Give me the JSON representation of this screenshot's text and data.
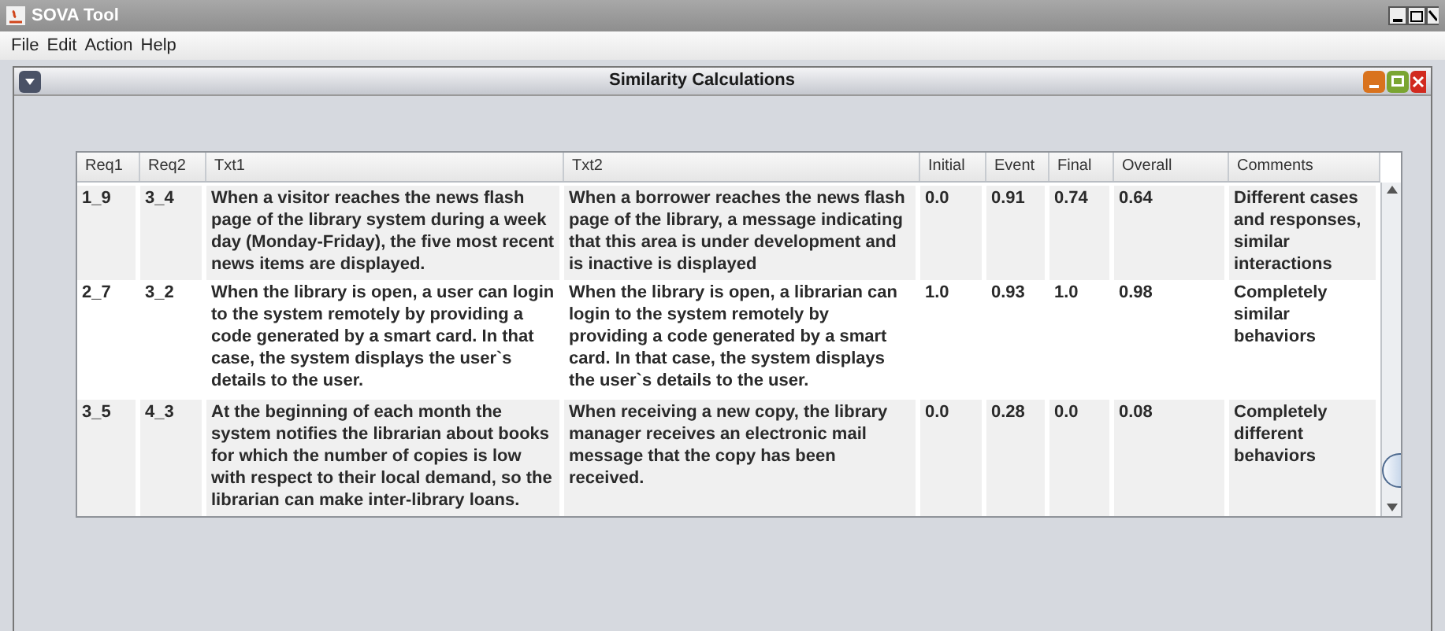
{
  "window": {
    "title": "SOVA Tool"
  },
  "menu": [
    "File",
    "Edit",
    "Action",
    "Help"
  ],
  "frame": {
    "title": "Similarity Calculations"
  },
  "table": {
    "columns": [
      "Req1",
      "Req2",
      "Txt1",
      "Txt2",
      "Initial",
      "Event",
      "Final",
      "Overall",
      "Comments"
    ],
    "rows": [
      {
        "cells": [
          "1_9",
          "3_4",
          "When a visitor reaches the news flash page of the library system during a week day (Monday-Friday), the five most recent news items are displayed.",
          "When a borrower reaches the news flash page of the library, a message indicating that this area is under development and is inactive is displayed",
          "0.0",
          "0.91",
          "0.74",
          "0.64",
          "Different cases and responses, similar interactions"
        ]
      },
      {
        "cells": [
          "2_7",
          "3_2",
          "When the library is open, a user can login to the system remotely by providing a code generated by a smart card. In that case, the system displays the user`s details to the user.",
          "When the library is open, a librarian can login to the system remotely by providing a code generated by a smart card. In that case, the system displays the user`s details to the user.",
          "1.0",
          "0.93",
          "1.0",
          "0.98",
          "Completely similar behaviors"
        ]
      },
      {
        "cells": [
          "3_5",
          "4_3",
          "At the beginning of each month the system notifies the librarian about books for which the number of copies is low with respect to their local demand, so the librarian can make inter-library loans.",
          "When receiving a new copy, the library manager receives an electronic mail message that the copy has been received.",
          "0.0",
          "0.28",
          "0.0",
          "0.08",
          "Completely different behaviors"
        ]
      }
    ]
  }
}
